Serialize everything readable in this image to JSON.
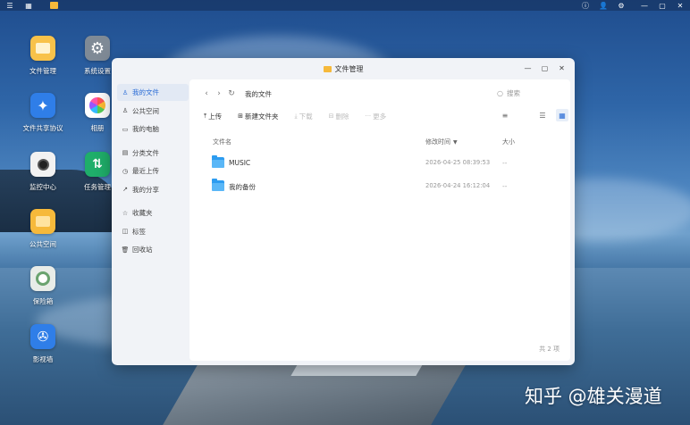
{
  "topbar": {
    "icons": [
      "menu-icon",
      "apps-grid-icon",
      "file-manager-icon",
      "info-icon",
      "user-icon",
      "gear-icon",
      "minimize-icon",
      "restore-icon",
      "close-icon"
    ]
  },
  "desktop": {
    "icons": [
      {
        "label": "文件管理"
      },
      {
        "label": "系统设置"
      },
      {
        "label": "文件共享协议"
      },
      {
        "label": "相册"
      },
      {
        "label": "监控中心"
      },
      {
        "label": "任务管理"
      },
      {
        "label": "公共空间"
      },
      {
        "label": "保险箱"
      },
      {
        "label": "影视墙"
      }
    ]
  },
  "window": {
    "title": "文件管理",
    "sidebar": {
      "items": [
        {
          "label": "我的文件",
          "icon": "person-icon",
          "active": true
        },
        {
          "label": "公共空间",
          "icon": "people-icon",
          "active": false
        },
        {
          "label": "我的电脑",
          "icon": "monitor-icon",
          "active": false
        },
        {
          "label": "分类文件",
          "icon": "category-icon",
          "active": false
        },
        {
          "label": "最近上传",
          "icon": "clock-icon",
          "active": false
        },
        {
          "label": "我的分享",
          "icon": "share-icon",
          "active": false
        },
        {
          "label": "收藏夹",
          "icon": "star-icon",
          "active": false
        },
        {
          "label": "标签",
          "icon": "tag-icon",
          "active": false
        },
        {
          "label": "回收站",
          "icon": "trash-icon",
          "active": false
        }
      ]
    },
    "nav": {
      "breadcrumb": "我的文件",
      "search_placeholder": "搜索"
    },
    "toolbar": {
      "upload": "上传",
      "new_folder": "新建文件夹",
      "download": "下载",
      "delete": "删除",
      "more": "更多"
    },
    "table": {
      "headers": {
        "name": "文件名",
        "modified": "修改时间",
        "size": "大小"
      },
      "rows": [
        {
          "name": "MUSIC",
          "modified": "2026-04-25 08:39:53",
          "size": "--"
        },
        {
          "name": "我的备份",
          "modified": "2026-04-24 16:12:04",
          "size": "--"
        }
      ]
    },
    "footer": "共 2 项"
  },
  "watermark": "知乎 @雄关漫道",
  "colors": {
    "accent": "#2a6cd6",
    "folder": "#2d9cf0",
    "file_manager_tile": "#f6b93b"
  }
}
